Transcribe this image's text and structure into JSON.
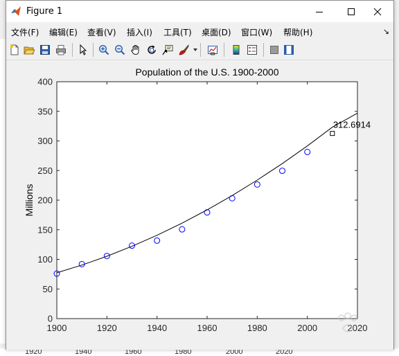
{
  "window": {
    "title": "Figure 1",
    "controls": [
      "minimize",
      "maximize",
      "close"
    ]
  },
  "menu": {
    "items": [
      "文件(F)",
      "编辑(E)",
      "查看(V)",
      "插入(I)",
      "工具(T)",
      "桌面(D)",
      "窗口(W)",
      "帮助(H)"
    ]
  },
  "toolbar": {
    "tools": [
      "new-figure-icon",
      "open-file-icon",
      "save-icon",
      "print-icon",
      "pointer-icon",
      "zoom-in-icon",
      "zoom-out-icon",
      "pan-hand-icon",
      "rotate-3d-icon",
      "data-cursor-icon",
      "brush-icon",
      "link-plot-icon",
      "colorbar-icon",
      "legend-icon",
      "hide-plot-tools-icon",
      "show-plot-tools-icon"
    ]
  },
  "background": {
    "axis_tick_labels": [
      "1920",
      "1940",
      "1960",
      "1980",
      "2000",
      "2020"
    ]
  },
  "chart_data": {
    "type": "scatter",
    "title": "Population of the U.S. 1900-2000",
    "xlabel": "",
    "ylabel": "Millions",
    "xlim": [
      1900,
      2020
    ],
    "ylim": [
      0,
      400
    ],
    "xticks": [
      1900,
      1920,
      1940,
      1960,
      1980,
      2000,
      2020
    ],
    "yticks": [
      0,
      50,
      100,
      150,
      200,
      250,
      300,
      350,
      400
    ],
    "grid": false,
    "series": [
      {
        "kind": "markers",
        "marker": "circle",
        "color": "#0000ff",
        "x": [
          1900,
          1910,
          1920,
          1930,
          1940,
          1950,
          1960,
          1970,
          1980,
          1990,
          2000
        ],
        "y": [
          75.995,
          91.972,
          105.711,
          123.203,
          131.669,
          150.697,
          179.323,
          203.212,
          226.505,
          249.633,
          281.422
        ]
      },
      {
        "kind": "line",
        "color": "#000000",
        "x": [
          1900,
          1910,
          1920,
          1930,
          1940,
          1950,
          1960,
          1970,
          1980,
          1990,
          2000,
          2010,
          2020
        ],
        "y": [
          77.3,
          90.4,
          105.3,
          122.1,
          140.7,
          161.2,
          183.6,
          207.8,
          233.9,
          261.8,
          291.6,
          323.3,
          346.9
        ]
      }
    ],
    "annotation": {
      "marker": "square",
      "x": 2010,
      "y": 312.6914,
      "text": "312.6914"
    }
  }
}
